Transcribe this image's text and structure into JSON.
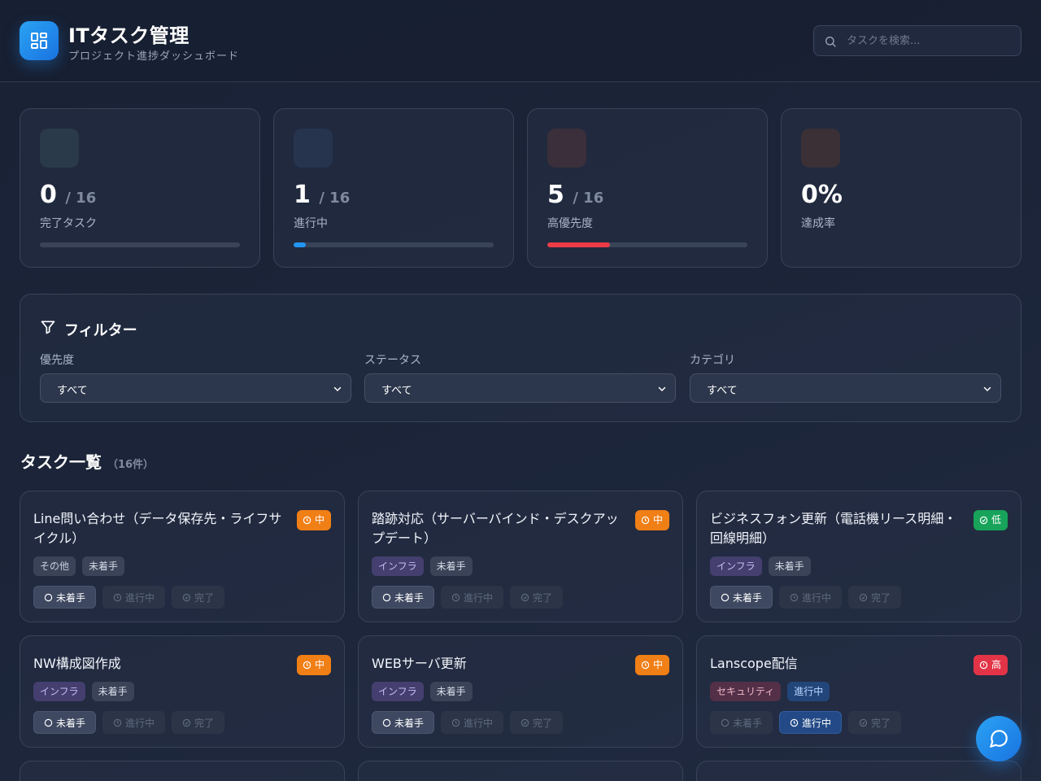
{
  "header": {
    "title": "ITタスク管理",
    "subtitle": "プロジェクト進捗ダッシュボード",
    "search_placeholder": "タスクを検索..."
  },
  "stats": [
    {
      "value": "0",
      "total": "/ 16",
      "label": "完了タスク",
      "progress": 0.0,
      "color": "#22c55e"
    },
    {
      "value": "1",
      "total": "/ 16",
      "label": "進行中",
      "progress": 0.0625,
      "color": "#2196f3"
    },
    {
      "value": "5",
      "total": "/ 16",
      "label": "高優先度",
      "progress": 0.3125,
      "color": "#ef3b48"
    },
    {
      "value": "0%",
      "total": "",
      "label": "達成率",
      "progress": null,
      "color": "#f59e0b"
    }
  ],
  "filter": {
    "title": "フィルター",
    "priority_label": "優先度",
    "priority_value": "すべて",
    "status_label": "ステータス",
    "status_value": "すべて",
    "category_label": "カテゴリ",
    "category_value": "すべて"
  },
  "task_list": {
    "title": "タスク一覧",
    "count": "（16件）"
  },
  "status_options": {
    "todo": "未着手",
    "progress": "進行中",
    "done": "完了"
  },
  "tasks": [
    {
      "title": "Line問い合わせ（データ保存先・ライフサイクル）",
      "priority": "中",
      "priority_class": "mid",
      "category": "その他",
      "status": "未着手"
    },
    {
      "title": "踏跡対応（サーバーバインド・デスクアップデート）",
      "priority": "中",
      "priority_class": "mid",
      "category": "インフラ",
      "status": "未着手"
    },
    {
      "title": "ビジネスフォン更新（電話機リース明細・回線明細）",
      "priority": "低",
      "priority_class": "low",
      "category": "インフラ",
      "status": "未着手"
    },
    {
      "title": "NW構成図作成",
      "priority": "中",
      "priority_class": "mid",
      "category": "インフラ",
      "status": "未着手"
    },
    {
      "title": "WEBサーバ更新",
      "priority": "中",
      "priority_class": "mid",
      "category": "インフラ",
      "status": "未着手"
    },
    {
      "title": "Lanscope配信",
      "priority": "高",
      "priority_class": "high",
      "category": "セキュリティ",
      "status": "進行中"
    }
  ],
  "colors": {
    "accent": "#1e88e5",
    "priority_mid": "#f07f16",
    "priority_low": "#17a35a",
    "priority_high": "#e33447"
  },
  "icons": {
    "logo": "dashboard-grid-icon",
    "search": "search-icon",
    "filter": "funnel-icon",
    "chat": "chat-bubble-icon"
  }
}
